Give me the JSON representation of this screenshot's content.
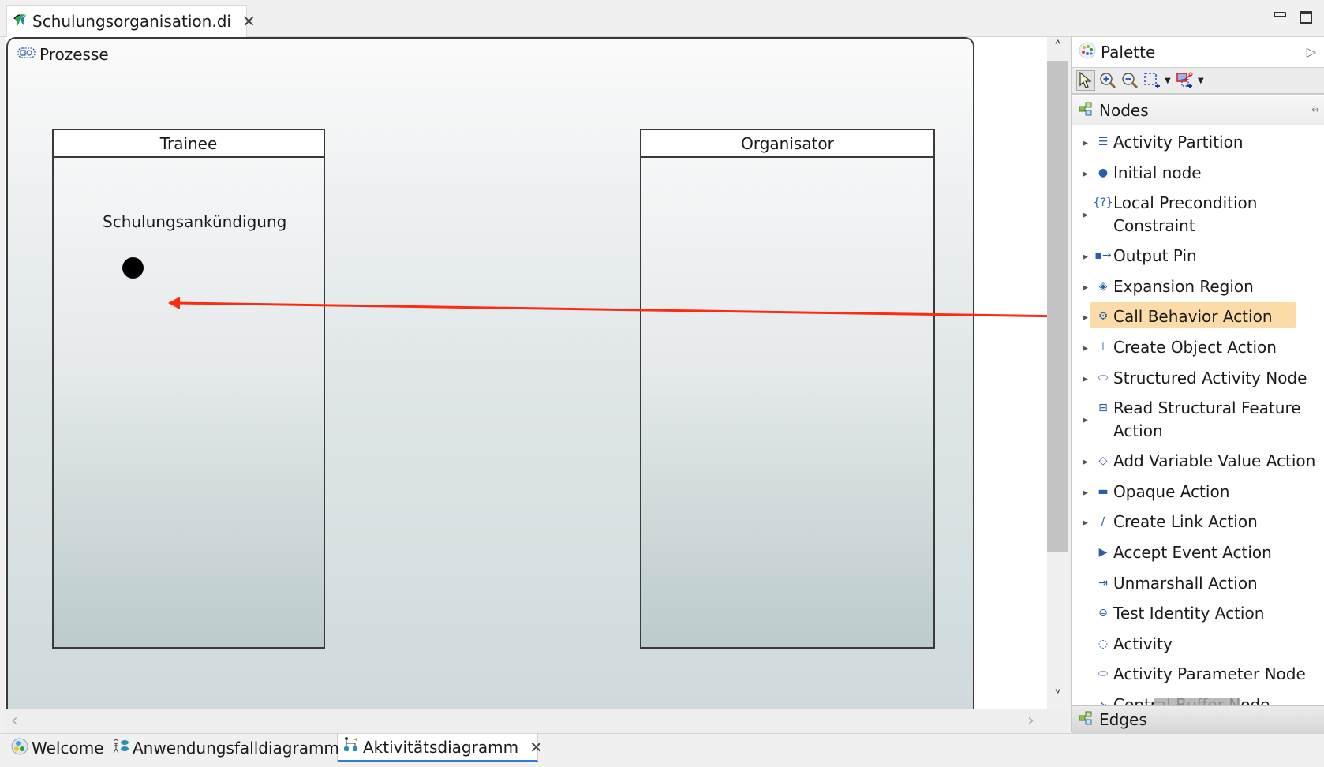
{
  "editor_tab": {
    "title": "Schulungsorganisation.di",
    "icon": "papyrus-logo-icon",
    "close": "✕"
  },
  "window_controls": {
    "minimize": "minimize-icon",
    "maximize": "maximize-icon"
  },
  "diagram": {
    "frame_title": "Prozesse",
    "frame_icon": "activity-icon",
    "lanes": [
      {
        "name": "Trainee"
      },
      {
        "name": "Organisator"
      }
    ],
    "node_label": "Schulungsankündigung",
    "initial_node": "initial-node",
    "drag_arrow_color": "#ff2a12"
  },
  "scrollbars": {
    "up": "˄",
    "down": "˅",
    "left": "‹",
    "right": "›"
  },
  "palette": {
    "title": "Palette",
    "collapse_glyph": "▷",
    "tools": [
      "select-tool",
      "zoom-in-tool",
      "zoom-out-tool",
      "marquee-tool",
      "connection-marquee-tool"
    ],
    "drawers": [
      {
        "label": "Nodes",
        "pin_glyph": "↔",
        "items": [
          {
            "label": "Activity Partition",
            "icon": "activity-partition-icon",
            "glyph": "☰",
            "expandable": true
          },
          {
            "label": "Initial node",
            "icon": "initial-node-icon",
            "glyph": "●",
            "expandable": true
          },
          {
            "label": "Local Precondition Constraint",
            "line1": "Local Precondition",
            "line2": "Constraint",
            "icon": "constraint-icon",
            "glyph": "{?}",
            "expandable": true
          },
          {
            "label": "Output Pin",
            "icon": "output-pin-icon",
            "glyph": "▪→",
            "expandable": true
          },
          {
            "label": "Expansion Region",
            "icon": "expansion-region-icon",
            "glyph": "◈",
            "expandable": true
          },
          {
            "label": "Call Behavior Action",
            "icon": "call-behavior-action-icon",
            "glyph": "⚙",
            "expandable": true,
            "highlighted": true
          },
          {
            "label": "Create Object Action",
            "icon": "create-object-action-icon",
            "glyph": "⊥",
            "expandable": true
          },
          {
            "label": "Structured Activity Node",
            "icon": "structured-activity-node-icon",
            "glyph": "⬭",
            "expandable": true
          },
          {
            "label": "Read Structural Feature Action",
            "line1": "Read Structural Feature",
            "line2": "Action",
            "icon": "read-structural-feature-icon",
            "glyph": "⊟",
            "expandable": true
          },
          {
            "label": "Add Variable Value Action",
            "icon": "add-variable-value-icon",
            "glyph": "◇",
            "expandable": true
          },
          {
            "label": "Opaque Action",
            "icon": "opaque-action-icon",
            "glyph": "▬",
            "expandable": true
          },
          {
            "label": "Create Link Action",
            "icon": "create-link-action-icon",
            "glyph": "∕",
            "expandable": true
          },
          {
            "label": "Accept Event Action",
            "icon": "accept-event-action-icon",
            "glyph": "▶",
            "expandable": false
          },
          {
            "label": "Unmarshall Action",
            "icon": "unmarshall-action-icon",
            "glyph": "⇥",
            "expandable": false
          },
          {
            "label": "Test Identity Action",
            "icon": "test-identity-action-icon",
            "glyph": "⊜",
            "expandable": false
          },
          {
            "label": "Activity",
            "icon": "activity-icon",
            "glyph": "◌",
            "expandable": false
          },
          {
            "label": "Activity Parameter Node",
            "icon": "activity-parameter-node-icon",
            "glyph": "⬭",
            "expandable": false
          },
          {
            "label": "Central Buffer Node",
            "icon": "central-buffer-node-icon",
            "glyph": "↘",
            "expandable": false,
            "partially_visible": true
          }
        ]
      },
      {
        "label": "Edges"
      }
    ]
  },
  "bottom_tabs": [
    {
      "label": "Welcome",
      "icon": "welcome-icon",
      "active": false
    },
    {
      "label": "Anwendungsfalldiagramm",
      "icon": "use-case-diagram-icon",
      "active": false
    },
    {
      "label": "Aktivitätsdiagramm",
      "icon": "activity-diagram-icon",
      "active": true,
      "close": "✕"
    }
  ]
}
